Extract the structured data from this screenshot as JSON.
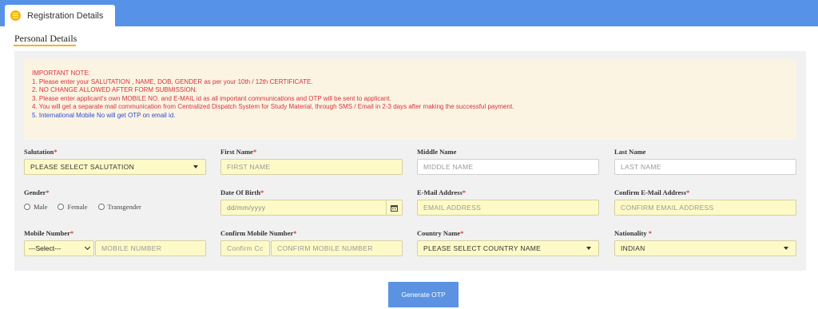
{
  "tab": {
    "label": "Registration Details"
  },
  "section": {
    "title": "Personal Details"
  },
  "notice": {
    "heading": "IMPORTANT NOTE:",
    "lines": [
      "1. Please enter your SALUTATION , NAME, DOB, GENDER as per your 10th / 12th CERTIFICATE.",
      "2. NO CHANGE ALLOWED AFTER FORM SUBMISSION.",
      "3. Please enter applicant's own MOBILE NO. and E-MAIL id as all important communications and OTP will be sent to applicant.",
      "4. You will get a separate mail communication from Centralized Dispatch System for Study Material, through SMS / Email in 2-3 days after making the successful payment.",
      "5. International Mobile No will get OTP on email id."
    ]
  },
  "fields": {
    "salutation": {
      "label": "Salutation",
      "value": "PLEASE SELECT SALUTATION"
    },
    "first_name": {
      "label": "First Name",
      "placeholder": "FIRST NAME"
    },
    "middle_name": {
      "label": "Middle Name",
      "placeholder": "MIDDLE NAME"
    },
    "last_name": {
      "label": "Last Name",
      "placeholder": "LAST NAME"
    },
    "gender": {
      "label": "Gender",
      "options": [
        "Male",
        "Female",
        "Transgender"
      ]
    },
    "dob": {
      "label": "Date Of Birth",
      "placeholder": "dd/mm/yyyy"
    },
    "email": {
      "label": "E-Mail Address",
      "placeholder": "EMAIL ADDRESS"
    },
    "confirm_email": {
      "label": "Confirm E-Mail Address",
      "placeholder": "CONFIRM EMAIL ADDRESS"
    },
    "mobile": {
      "label": "Mobile Number",
      "code_value": "---Select---",
      "placeholder": "MOBILE NUMBER"
    },
    "confirm_mobile": {
      "label": "Confirm Mobile Number",
      "code_placeholder": "Confirm Cc",
      "placeholder": "CONFIRM MOBILE NUMBER"
    },
    "country": {
      "label": "Country Name",
      "value": "PLEASE SELECT COUNTRY NAME"
    },
    "nationality": {
      "label": "Nationality",
      "value": "INDIAN"
    }
  },
  "required_mark": "*",
  "button": {
    "label": "Generate OTP"
  },
  "colors": {
    "header": "#5592e8",
    "accent": "#f0b429",
    "input_bg": "#fdfac8",
    "button": "#5b93e2",
    "required": "#e0342e"
  }
}
